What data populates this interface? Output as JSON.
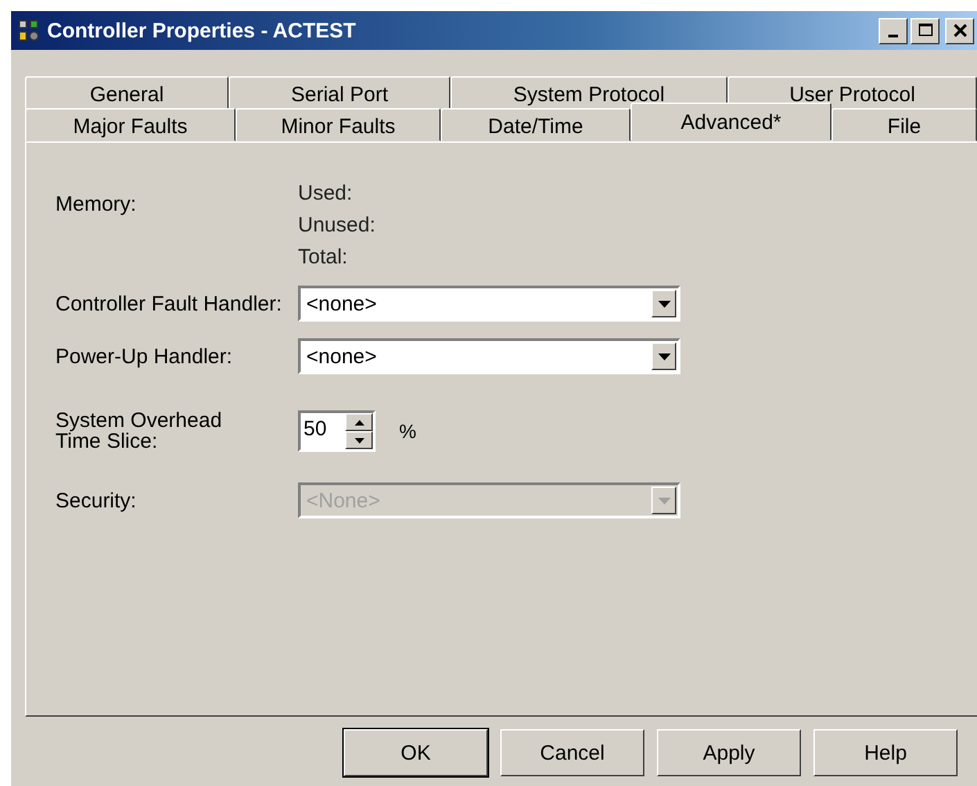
{
  "window": {
    "title": "Controller Properties - ACTEST"
  },
  "tab_rows": [
    [
      {
        "label": "General",
        "selected": false
      },
      {
        "label": "Serial Port",
        "selected": false
      },
      {
        "label": "System Protocol",
        "selected": false
      },
      {
        "label": "User Protocol",
        "selected": false
      }
    ],
    [
      {
        "label": "Major Faults",
        "selected": false
      },
      {
        "label": "Minor Faults",
        "selected": false
      },
      {
        "label": "Date/Time",
        "selected": false
      },
      {
        "label": "Advanced*",
        "selected": true
      },
      {
        "label": "File",
        "selected": false
      }
    ]
  ],
  "memory": {
    "label": "Memory:",
    "items": [
      "Used:",
      "Unused:",
      "Total:"
    ]
  },
  "fields": [
    {
      "kind": "combo",
      "label": "Controller Fault Handler:",
      "value": "<none>",
      "disabled": false
    },
    {
      "kind": "combo",
      "label": "Power-Up Handler:",
      "value": "<none>",
      "disabled": false
    },
    {
      "kind": "spinner",
      "label": "System Overhead Time Slice:",
      "value": "50",
      "unit": "%",
      "disabled": false
    },
    {
      "kind": "combo",
      "label": "Security:",
      "value": "<None>",
      "disabled": true
    }
  ],
  "buttons": [
    {
      "label": "OK",
      "default": true
    },
    {
      "label": "Cancel",
      "default": false
    },
    {
      "label": "Apply",
      "default": false
    },
    {
      "label": "Help",
      "default": false
    }
  ]
}
